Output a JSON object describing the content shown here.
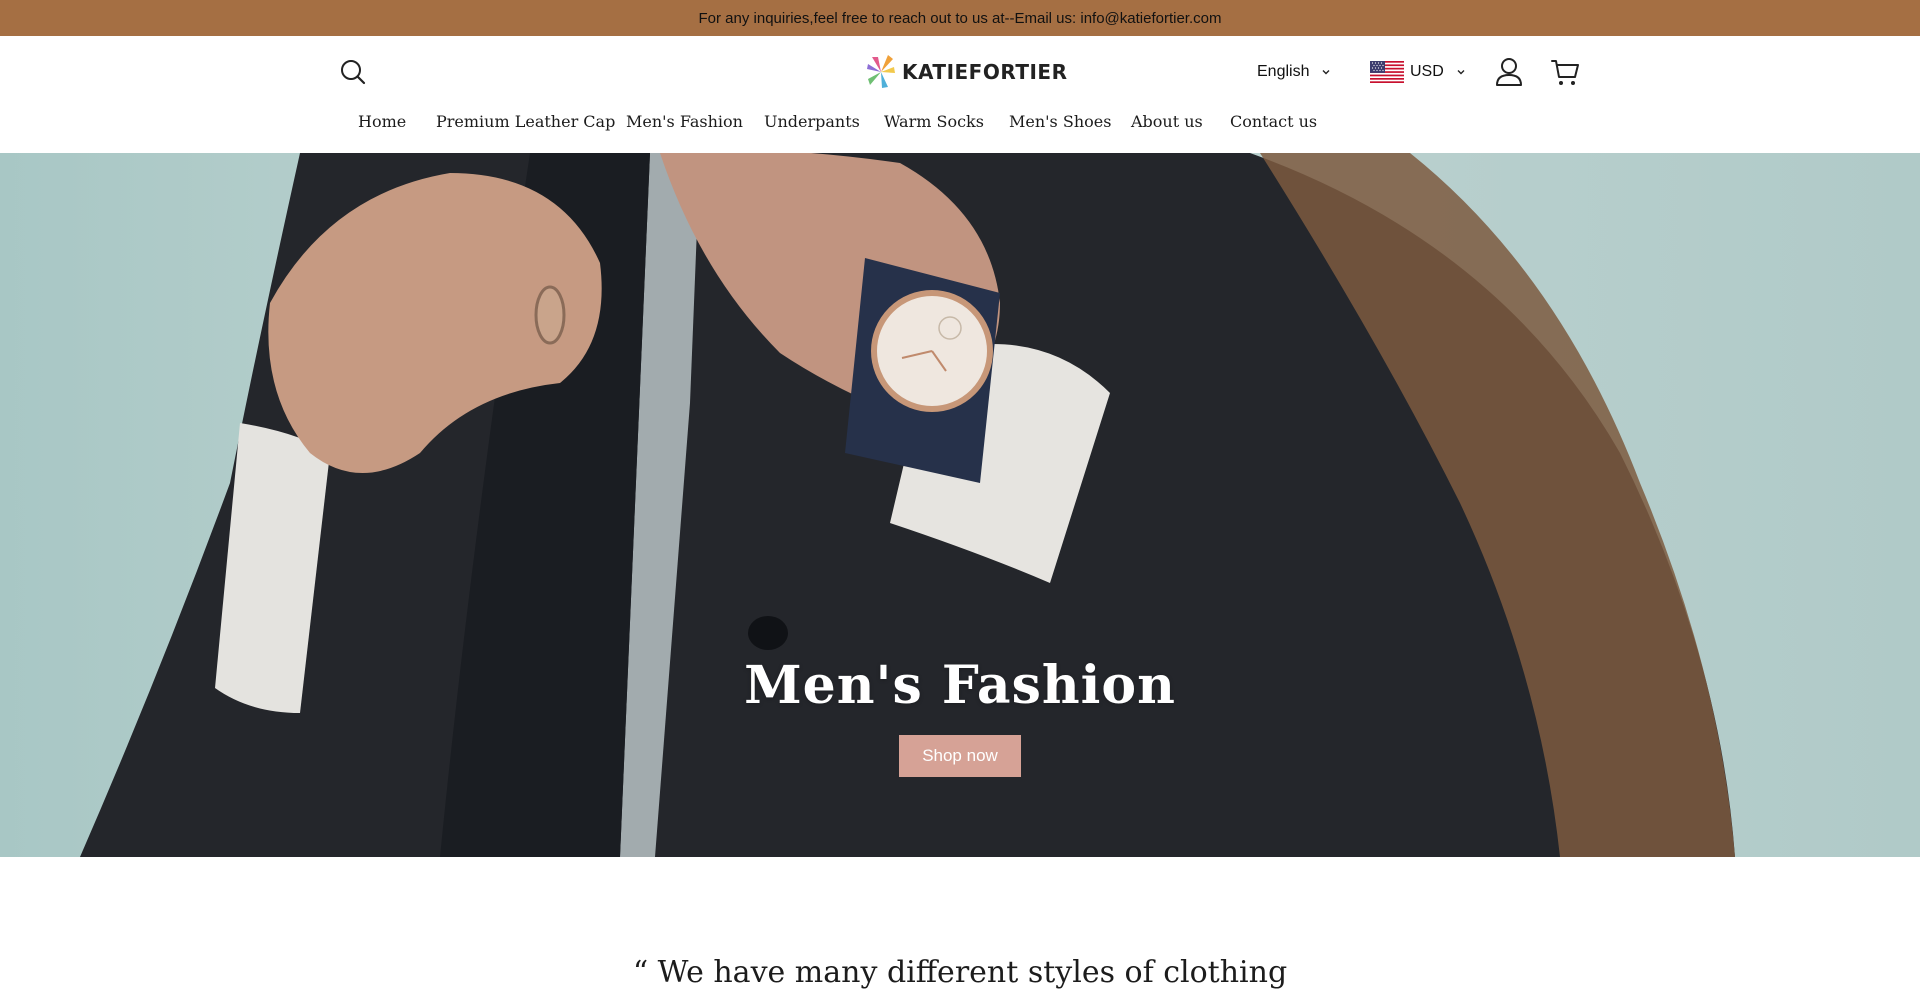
{
  "announcement": {
    "text": "For any inquiries,feel free to reach out to us at--Email us: info@katiefortier.com"
  },
  "header": {
    "logo_text": "KATIEFORTIER",
    "language": "English",
    "currency": "USD",
    "icons": {
      "search": "search-icon",
      "account": "user-icon",
      "cart": "cart-icon",
      "flag": "us-flag-icon"
    }
  },
  "nav": {
    "items": [
      {
        "label": "Home"
      },
      {
        "label": "Premium Leather Cap"
      },
      {
        "label": "Men's Fashion"
      },
      {
        "label": "Underpants"
      },
      {
        "label": "Warm Socks"
      },
      {
        "label": "Men's Shoes"
      },
      {
        "label": "About us"
      },
      {
        "label": "Contact us"
      }
    ]
  },
  "hero": {
    "title": "Men's Fashion",
    "button_label": "Shop now"
  },
  "quote": {
    "text": "“ We have many different styles of clothing"
  },
  "colors": {
    "announcement_bg": "#a56f43",
    "button_bg": "#d6a296"
  }
}
